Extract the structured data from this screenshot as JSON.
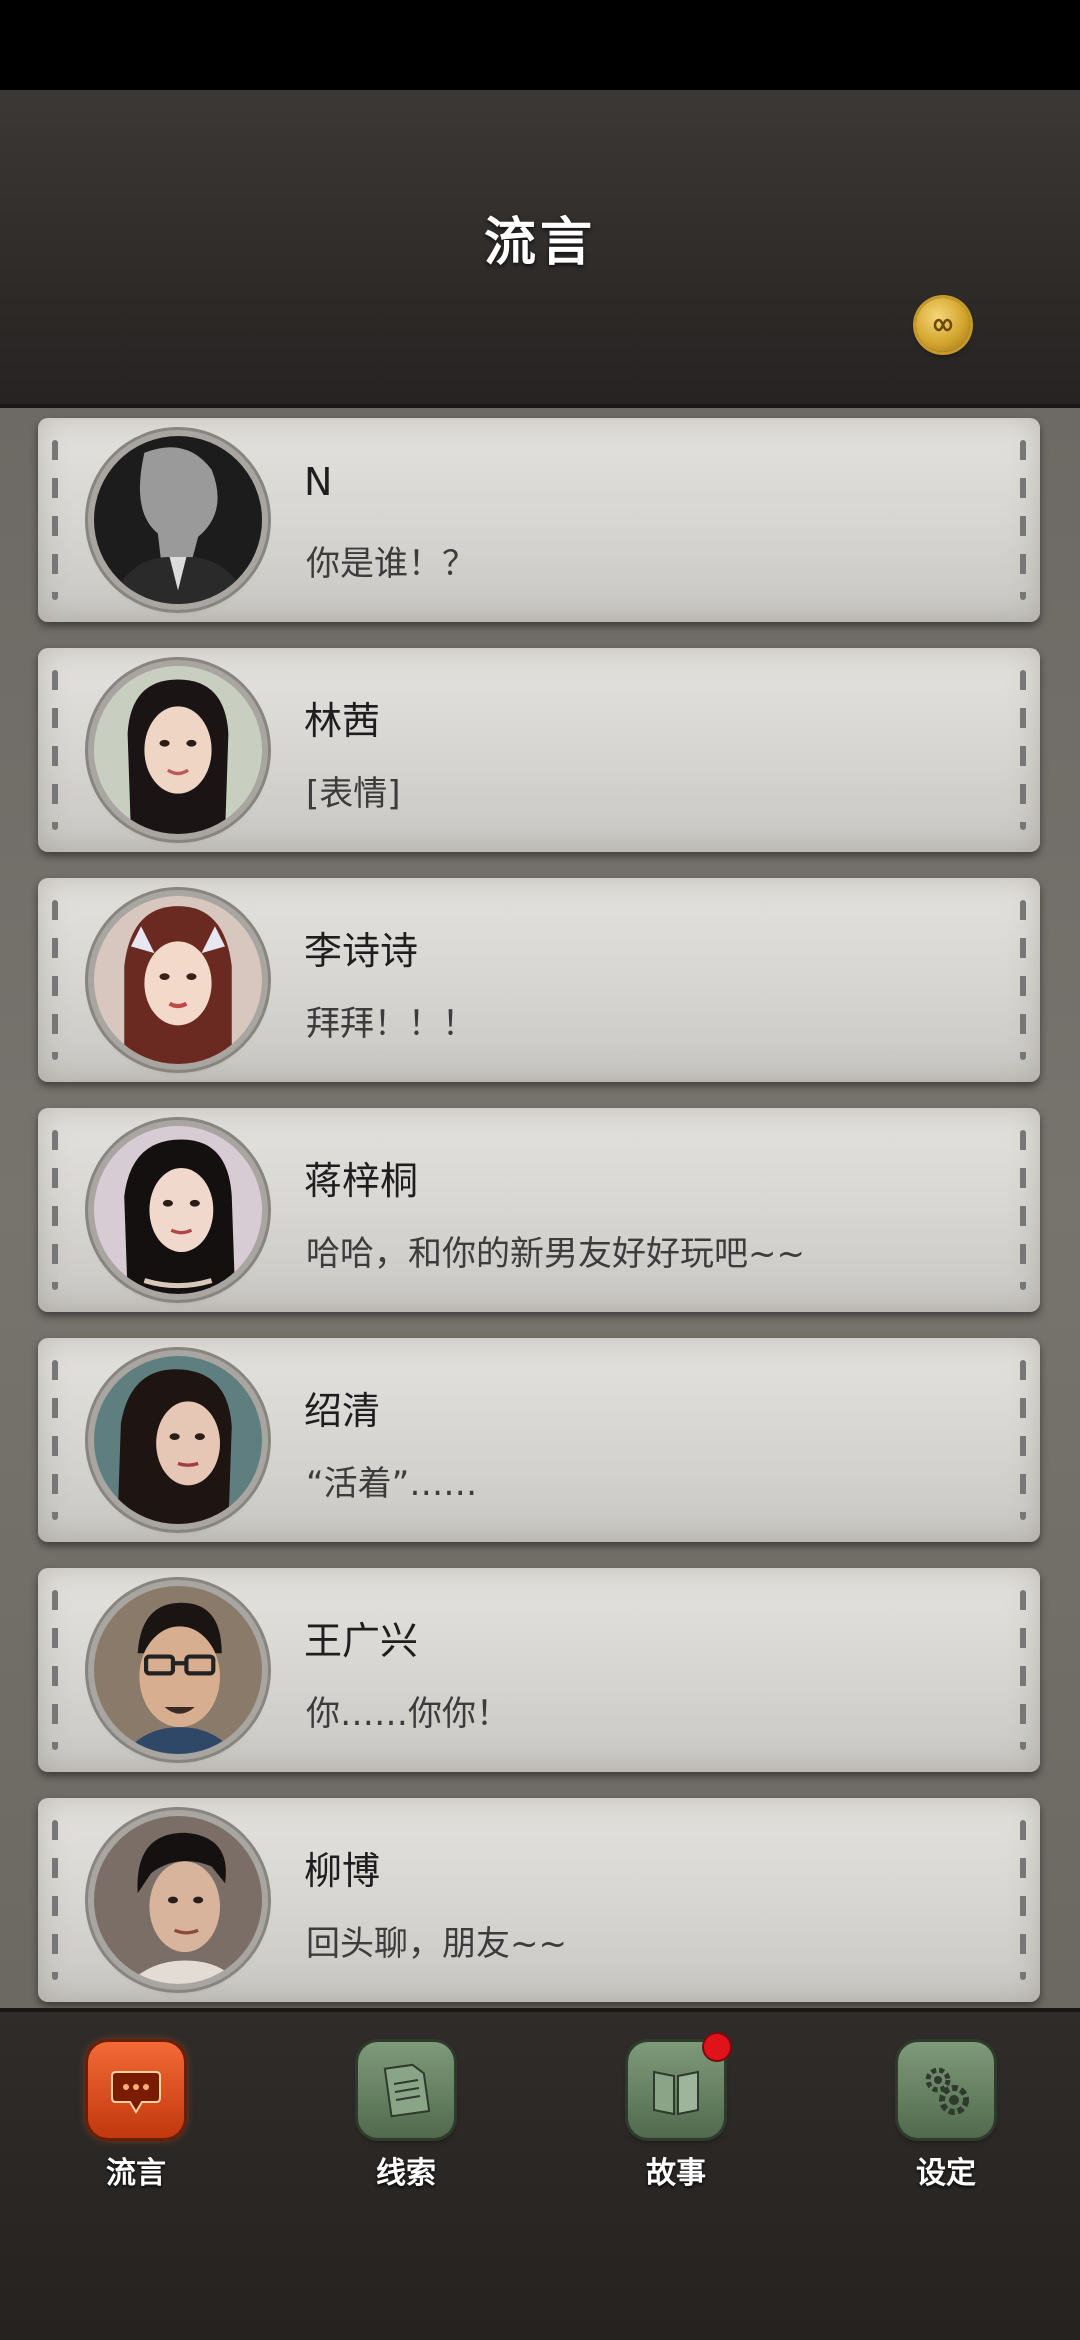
{
  "header": {
    "title": "流言"
  },
  "contacts": [
    {
      "name": "N",
      "message": "你是谁！？"
    },
    {
      "name": "林茜",
      "message": "[表情]"
    },
    {
      "name": "李诗诗",
      "message": "拜拜！！！"
    },
    {
      "name": "蒋梓桐",
      "message": "哈哈，和你的新男友好好玩吧~~"
    },
    {
      "name": "绍清",
      "message": "“活着”……"
    },
    {
      "name": "王广兴",
      "message": "你……你你！"
    },
    {
      "name": "柳博",
      "message": "回头聊，朋友~~"
    }
  ],
  "tabs": [
    {
      "label": "流言",
      "icon": "chat-bubble-icon",
      "active": true
    },
    {
      "label": "线索",
      "icon": "document-icon",
      "active": false
    },
    {
      "label": "故事",
      "icon": "book-icon",
      "active": false,
      "badge": true
    },
    {
      "label": "设定",
      "icon": "gears-icon",
      "active": false
    }
  ],
  "colors": {
    "active_tab": "#e5531f",
    "inactive_tab": "#6a8566",
    "badge": "#e0121a",
    "coin": "#d4a52f"
  }
}
